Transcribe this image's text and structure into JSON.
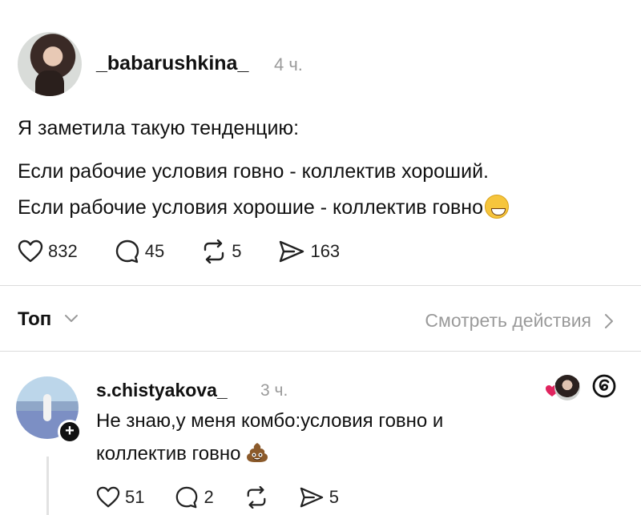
{
  "post": {
    "username": "_babarushkina_",
    "time": "4 ч.",
    "lines": [
      "Я заметила такую тенденцию:",
      "Если рабочие условия говно - коллектив хороший.",
      "Если рабочие условия хорошие - коллектив говно"
    ],
    "actions": {
      "likes": "832",
      "replies": "45",
      "reposts": "5",
      "shares": "163"
    }
  },
  "sort": {
    "label": "Топ",
    "activity_link": "Смотреть действия"
  },
  "reply": {
    "username": "s.chistyakova_",
    "time": "3 ч.",
    "lines": [
      "Не знаю,у меня комбо:условия говно и",
      "коллектив говно"
    ],
    "actions": {
      "likes": "51",
      "replies": "2",
      "shares": "5"
    }
  },
  "icons": {
    "like": "heart-icon",
    "reply": "speech-bubble-icon",
    "repost": "repost-icon",
    "share": "send-icon",
    "threads": "threads-logo-icon"
  },
  "colors": {
    "accent_like": "#e0245e",
    "secondary_text": "#9a9a9a"
  }
}
